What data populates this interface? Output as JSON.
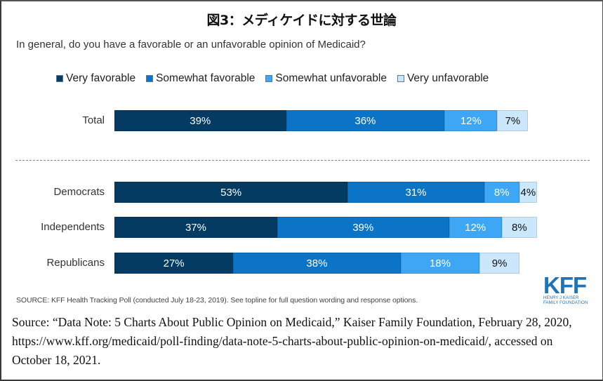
{
  "title": "図3：メディケイドに対する世論",
  "question": "In general, do you have a favorable or an unfavorable opinion of Medicaid?",
  "legend": [
    {
      "label": "Very favorable",
      "color": "#033b62"
    },
    {
      "label": "Somewhat favorable",
      "color": "#0b74c6"
    },
    {
      "label": "Somewhat unfavorable",
      "color": "#3ea7f5"
    },
    {
      "label": "Very unfavorable",
      "color": "#cbe7fb"
    }
  ],
  "source_note": "SOURCE: KFF Health Tracking Poll (conducted July 18-23, 2019). See topline for full question wording and response options.",
  "logo": {
    "main": "KFF",
    "line1": "HENRY J KAISER",
    "line2": "FAMILY FOUNDATION"
  },
  "citation": "Source: “Data Note: 5 Charts About Public Opinion on Medicaid,” Kaiser Family Foundation, February 28, 2020, https://www.kff.org/medicaid/poll-finding/data-note-5-charts-about-public-opinion-on-medicaid/, accessed on October 18, 2021.",
  "chart_data": {
    "type": "bar",
    "orientation": "horizontal",
    "stacked": true,
    "title": "図3：メディケイドに対する世論",
    "subtitle": "In general, do you have a favorable or an unfavorable opinion of Medicaid?",
    "xlabel": "",
    "ylabel": "",
    "xlim": [
      0,
      100
    ],
    "grid": false,
    "legend_position": "top",
    "categories": [
      "Total",
      "Democrats",
      "Independents",
      "Republicans"
    ],
    "series": [
      {
        "name": "Very favorable",
        "values": [
          39,
          53,
          37,
          27
        ],
        "color": "#033b62",
        "label_color": "#ffffff"
      },
      {
        "name": "Somewhat favorable",
        "values": [
          36,
          31,
          39,
          38
        ],
        "color": "#0b74c6",
        "label_color": "#ffffff"
      },
      {
        "name": "Somewhat unfavorable",
        "values": [
          12,
          8,
          12,
          18
        ],
        "color": "#3ea7f5",
        "label_color": "#ffffff"
      },
      {
        "name": "Very unfavorable",
        "values": [
          7,
          4,
          8,
          9
        ],
        "color": "#cbe7fb",
        "label_color": "#111111"
      }
    ],
    "data_labels": [
      [
        "39%",
        "36%",
        "12%",
        "7%"
      ],
      [
        "53%",
        "31%",
        "8%",
        "4%"
      ],
      [
        "37%",
        "39%",
        "12%",
        "8%"
      ],
      [
        "27%",
        "38%",
        "18%",
        "9%"
      ]
    ],
    "group_separator_after": "Total"
  }
}
